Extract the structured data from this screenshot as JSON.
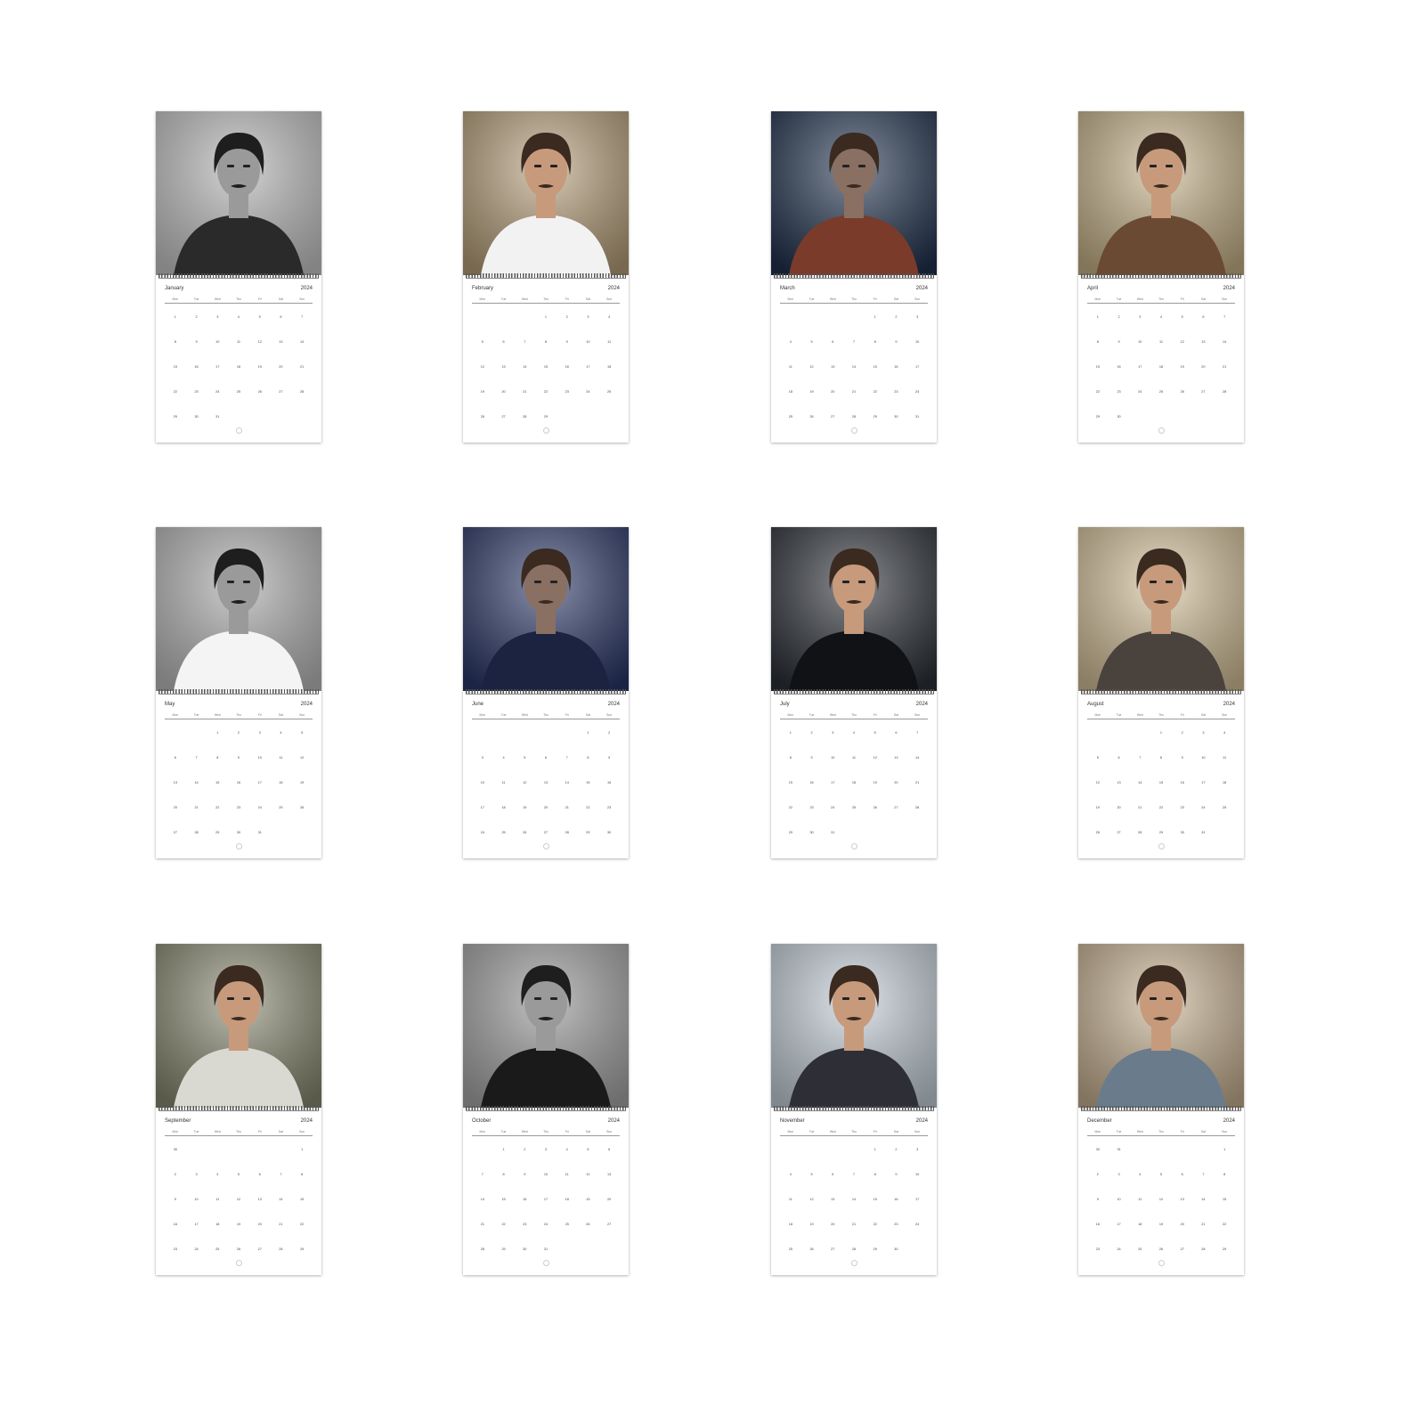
{
  "year": "2024",
  "weekday_labels": [
    "Mon",
    "Tue",
    "Wed",
    "Thu",
    "Fri",
    "Sat",
    "Sun"
  ],
  "months": [
    {
      "name": "January",
      "offset": 0,
      "days": 31,
      "photo": {
        "tone": "mono",
        "bg": "#c9c9c9",
        "accent": "#2a2a2a"
      }
    },
    {
      "name": "February",
      "offset": 3,
      "days": 29,
      "photo": {
        "tone": "warm",
        "bg": "#b8a07a",
        "accent": "#f2f2f2"
      }
    },
    {
      "name": "March",
      "offset": 4,
      "days": 31,
      "photo": {
        "tone": "night",
        "bg": "#20324e",
        "accent": "#7a3b2a"
      }
    },
    {
      "name": "April",
      "offset": 0,
      "days": 30,
      "photo": {
        "tone": "warm",
        "bg": "#c8b48a",
        "accent": "#6b4a33"
      }
    },
    {
      "name": "May",
      "offset": 2,
      "days": 31,
      "photo": {
        "tone": "mono",
        "bg": "#bdbdbd",
        "accent": "#f4f4f4"
      }
    },
    {
      "name": "June",
      "offset": 5,
      "days": 30,
      "photo": {
        "tone": "night",
        "bg": "#2a3768",
        "accent": "#1b2340"
      }
    },
    {
      "name": "July",
      "offset": 0,
      "days": 31,
      "photo": {
        "tone": "event",
        "bg": "#2b2f36",
        "accent": "#101215"
      }
    },
    {
      "name": "August",
      "offset": 3,
      "days": 31,
      "photo": {
        "tone": "warm",
        "bg": "#d6c29a",
        "accent": "#4a423c"
      }
    },
    {
      "name": "September",
      "offset": 6,
      "days": 30,
      "photo": {
        "tone": "sunset",
        "bg": "#8a8a72",
        "accent": "#d9d9d2"
      }
    },
    {
      "name": "October",
      "offset": 1,
      "days": 31,
      "photo": {
        "tone": "mono",
        "bg": "#a9a9a9",
        "accent": "#1a1a1a"
      }
    },
    {
      "name": "November",
      "offset": 4,
      "days": 30,
      "photo": {
        "tone": "day",
        "bg": "#c7d2dc",
        "accent": "#2e2e36"
      }
    },
    {
      "name": "December",
      "offset": 6,
      "days": 31,
      "photo": {
        "tone": "warm",
        "bg": "#c9b392",
        "accent": "#6a7c8c"
      }
    }
  ]
}
